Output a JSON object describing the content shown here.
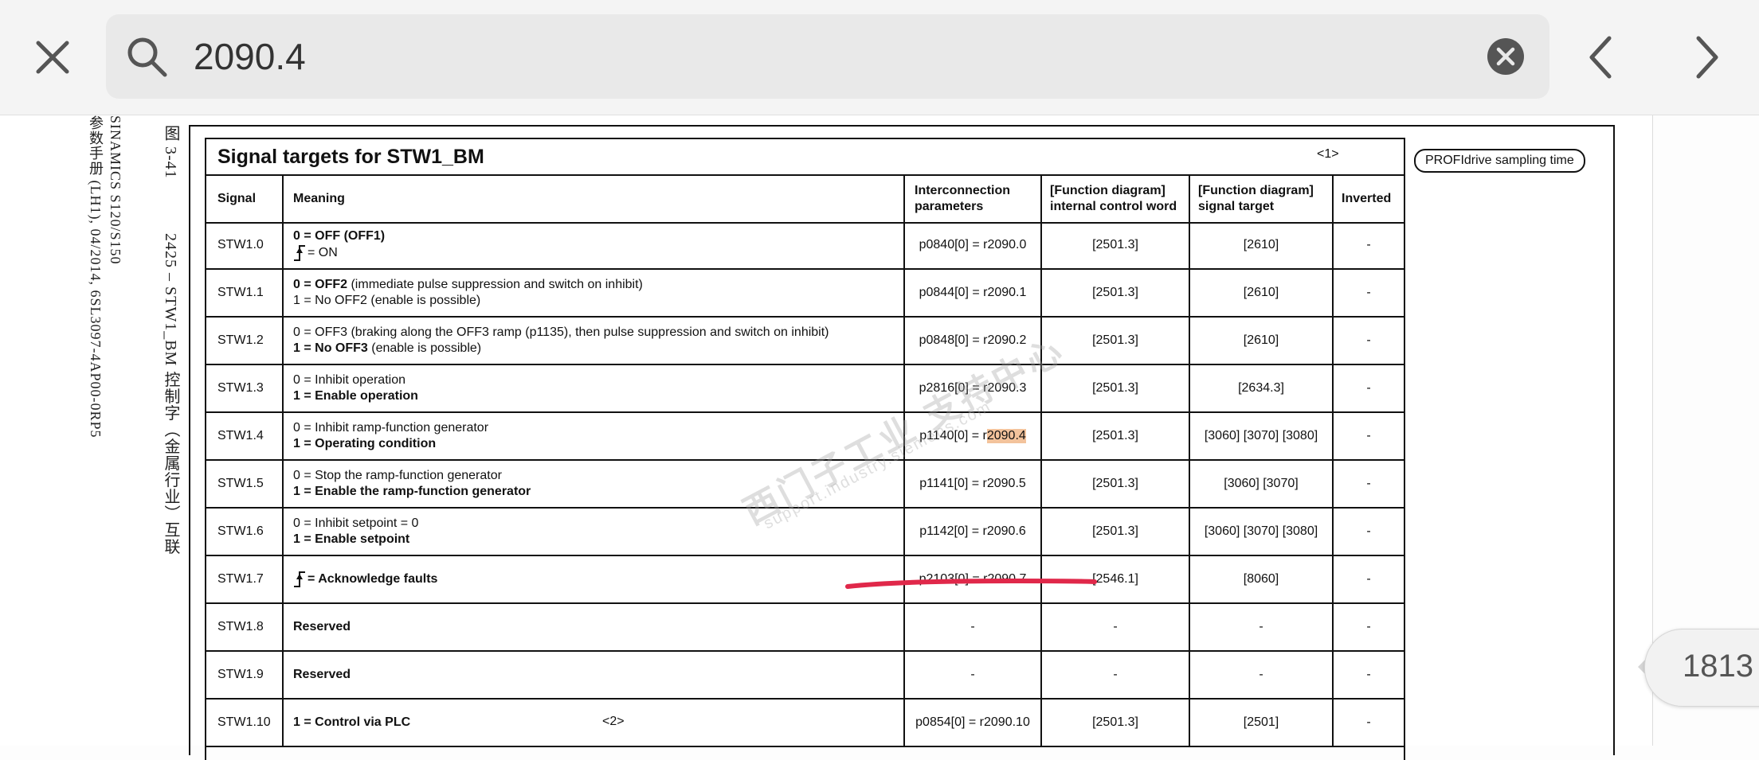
{
  "search": {
    "query": "2090.4"
  },
  "side": {
    "line1": "SINAMICS S120/S150",
    "line2": "参数手册 (LH1), 04/2014, 6SL3097-4AP00-0RP5",
    "figure_label": "图 3-41",
    "figure_title": "2425 – STW1_BM 控制字（金属行业）互联"
  },
  "table": {
    "title": "Signal targets for STW1_BM",
    "title_note": "<1>",
    "profidrive_badge": "PROFIdrive sampling time",
    "headers": {
      "signal": "Signal",
      "meaning": "Meaning",
      "interconnection_1": "Interconnection",
      "interconnection_2": "parameters",
      "fd_internal_1": "[Function diagram]",
      "fd_internal_2": "internal control word",
      "fd_target_1": "[Function diagram]",
      "fd_target_2": "signal target",
      "inverted": "Inverted"
    },
    "rows": [
      {
        "signal": "STW1.0",
        "m1_bold": "0 = OFF (OFF1)",
        "m2": "= ON",
        "param": "p0840[0] = r2090.0",
        "fd1": "[2501.3]",
        "fd2": "[2610]",
        "inv": "-"
      },
      {
        "signal": "STW1.1",
        "m1_bold": "0 = OFF2",
        "m1_rest": " (immediate pulse suppression and switch on inhibit)",
        "m2": "1 = No OFF2 (enable is possible)",
        "param": "p0844[0] = r2090.1",
        "fd1": "[2501.3]",
        "fd2": "[2610]",
        "inv": "-"
      },
      {
        "signal": "STW1.2",
        "m1": "0 = OFF3 (braking along the OFF3 ramp (p1135), then pulse suppression and switch on inhibit)",
        "m2_bold": "1 = No OFF3",
        "m2_rest": " (enable is possible)",
        "param": "p0848[0] = r2090.2",
        "fd1": "[2501.3]",
        "fd2": "[2610]",
        "inv": "-"
      },
      {
        "signal": "STW1.3",
        "m1": "0 = Inhibit operation",
        "m2_bold": "1 = Enable operation",
        "param": "p2816[0] = r2090.3",
        "fd1": "[2501.3]",
        "fd2": "[2634.3]",
        "inv": "-"
      },
      {
        "signal": "STW1.4",
        "m1": "0 = Inhibit ramp-function generator",
        "m2_bold": "1 = Operating condition",
        "param_pre": "p1140[0] = r",
        "param_hl": "2090.4",
        "fd1": "[2501.3]",
        "fd2": "[3060] [3070] [3080]",
        "inv": "-"
      },
      {
        "signal": "STW1.5",
        "m1": "0 = Stop the ramp-function generator",
        "m2_bold": "1 = Enable the ramp-function generator",
        "param": "p1141[0] = r2090.5",
        "fd1": "[2501.3]",
        "fd2": "[3060] [3070]",
        "inv": "-"
      },
      {
        "signal": "STW1.6",
        "m1": "0 = Inhibit setpoint = 0",
        "m2_bold": "1 = Enable setpoint",
        "param": "p1142[0] = r2090.6",
        "fd1": "[2501.3]",
        "fd2": "[3060] [3070] [3080]",
        "inv": "-"
      },
      {
        "signal": "STW1.7",
        "m1_bold": "= Acknowledge faults",
        "param": "p2103[0] = r2090.7",
        "fd1": "[2546.1]",
        "fd2": "[8060]",
        "inv": "-"
      },
      {
        "signal": "STW1.8",
        "m1_bold": "Reserved",
        "param": "-",
        "fd1": "-",
        "fd2": "-",
        "inv": "-"
      },
      {
        "signal": "STW1.9",
        "m1_bold": "Reserved",
        "param": "-",
        "fd1": "-",
        "fd2": "-",
        "inv": "-"
      },
      {
        "signal": "STW1.10",
        "m1_bold": "1 = Control via PLC",
        "note": "<2>",
        "param": "p0854[0] = r2090.10",
        "fd1": "[2501.3]",
        "fd2": "[2501]",
        "inv": "-"
      }
    ]
  },
  "watermark": {
    "main": "西门子工业 支持中心",
    "sub": "support.industry.siemens.com"
  },
  "page_number": "1813",
  "colors": {
    "highlight": "#f3c39c",
    "red_mark": "#e0284a",
    "toolbar_bg": "#f4f4f4"
  }
}
